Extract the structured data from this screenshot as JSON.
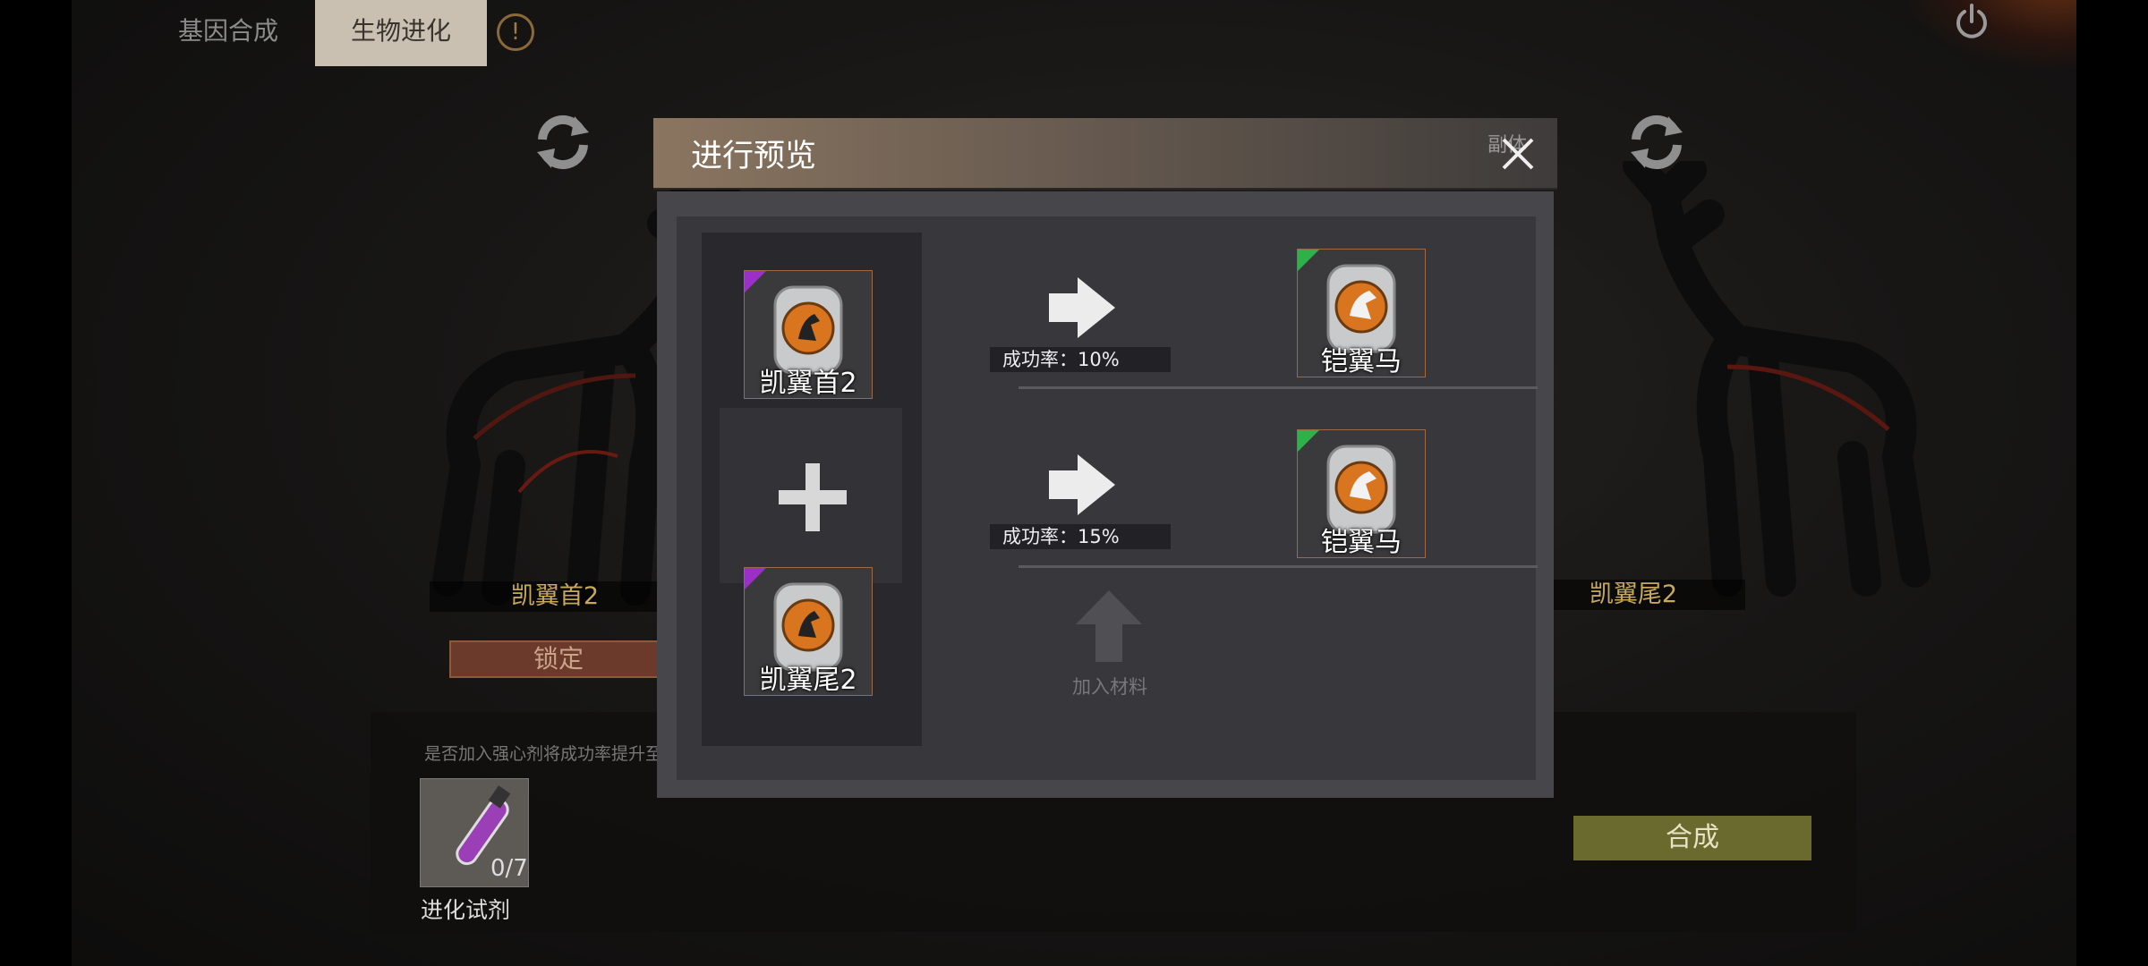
{
  "tabs": [
    {
      "label": "基因合成",
      "active": false
    },
    {
      "label": "生物进化",
      "active": true
    }
  ],
  "icons": {
    "warning": "warning-icon",
    "power": "power-icon",
    "refresh": "refresh-icon",
    "close": "close-icon",
    "plus": "plus-icon",
    "arrow": "arrow-right-icon",
    "add_material": "arrow-up-icon"
  },
  "left_creature": {
    "name": "凯翼首2",
    "lock_label": "锁定"
  },
  "right_creature": {
    "name": "凯翼尾2"
  },
  "bottom": {
    "hint": "是否加入强心剂将成功率提升至",
    "potion_count": "0/7",
    "potion_label": "进化试剂",
    "synth_label": "合成"
  },
  "modal": {
    "title": "进行预览",
    "subtitle": "副体",
    "inputs": [
      {
        "label": "凯翼首2",
        "rarity_color": "#9b30c9"
      },
      {
        "label": "凯翼尾2",
        "rarity_color": "#9b30c9"
      }
    ],
    "results": [
      {
        "label": "铠翼马",
        "rate_text": "成功率：10%",
        "rarity_color": "#2fb14a"
      },
      {
        "label": "铠翼马",
        "rate_text": "成功率：15%",
        "rarity_color": "#2fb14a"
      }
    ],
    "add_material_label": "加入材料"
  },
  "colors": {
    "accent_gold": "#c8a85a",
    "tab_active_bg": "#c9c0b2",
    "synth_button": "#6b6a2e",
    "lock_button": "#6b3a2a"
  }
}
